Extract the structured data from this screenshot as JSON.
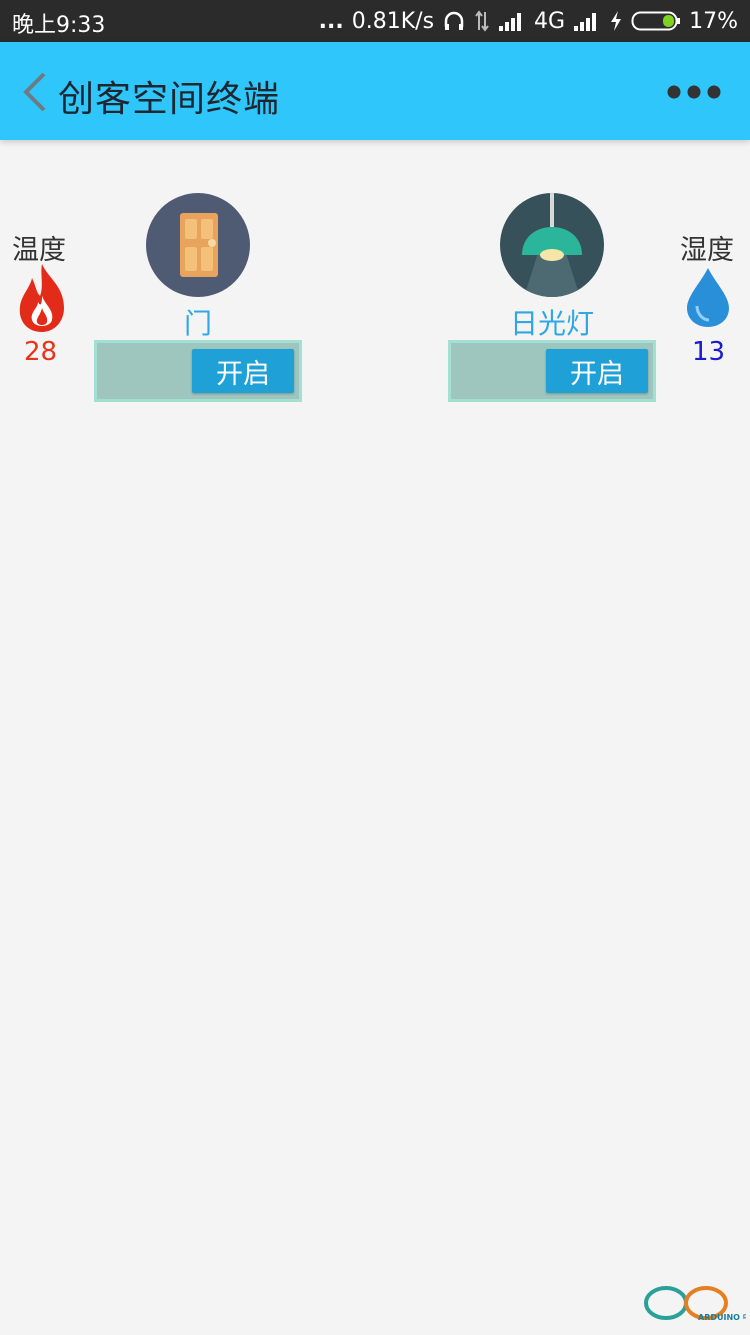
{
  "status_bar": {
    "time": "晚上9:33",
    "dots": "...",
    "speed": "0.81K/s",
    "network": "4G",
    "battery": "17%"
  },
  "header": {
    "title": "创客空间终端",
    "back_icon": "chevron-left-icon",
    "menu_icon": "more-dots-icon",
    "background": "#2ec6fb"
  },
  "sensors": {
    "temperature": {
      "label": "温度",
      "value": "28",
      "icon": "flame-icon",
      "color": "#e8341c"
    },
    "humidity": {
      "label": "湿度",
      "value": "13",
      "icon": "water-drop-icon",
      "color": "#1a1ad0"
    }
  },
  "devices": [
    {
      "name": "门",
      "icon": "door-icon",
      "button_label": "开启"
    },
    {
      "name": "日光灯",
      "icon": "lamp-icon",
      "button_label": "开启"
    }
  ],
  "watermark": {
    "text": "ARDUINO 中文社区"
  }
}
